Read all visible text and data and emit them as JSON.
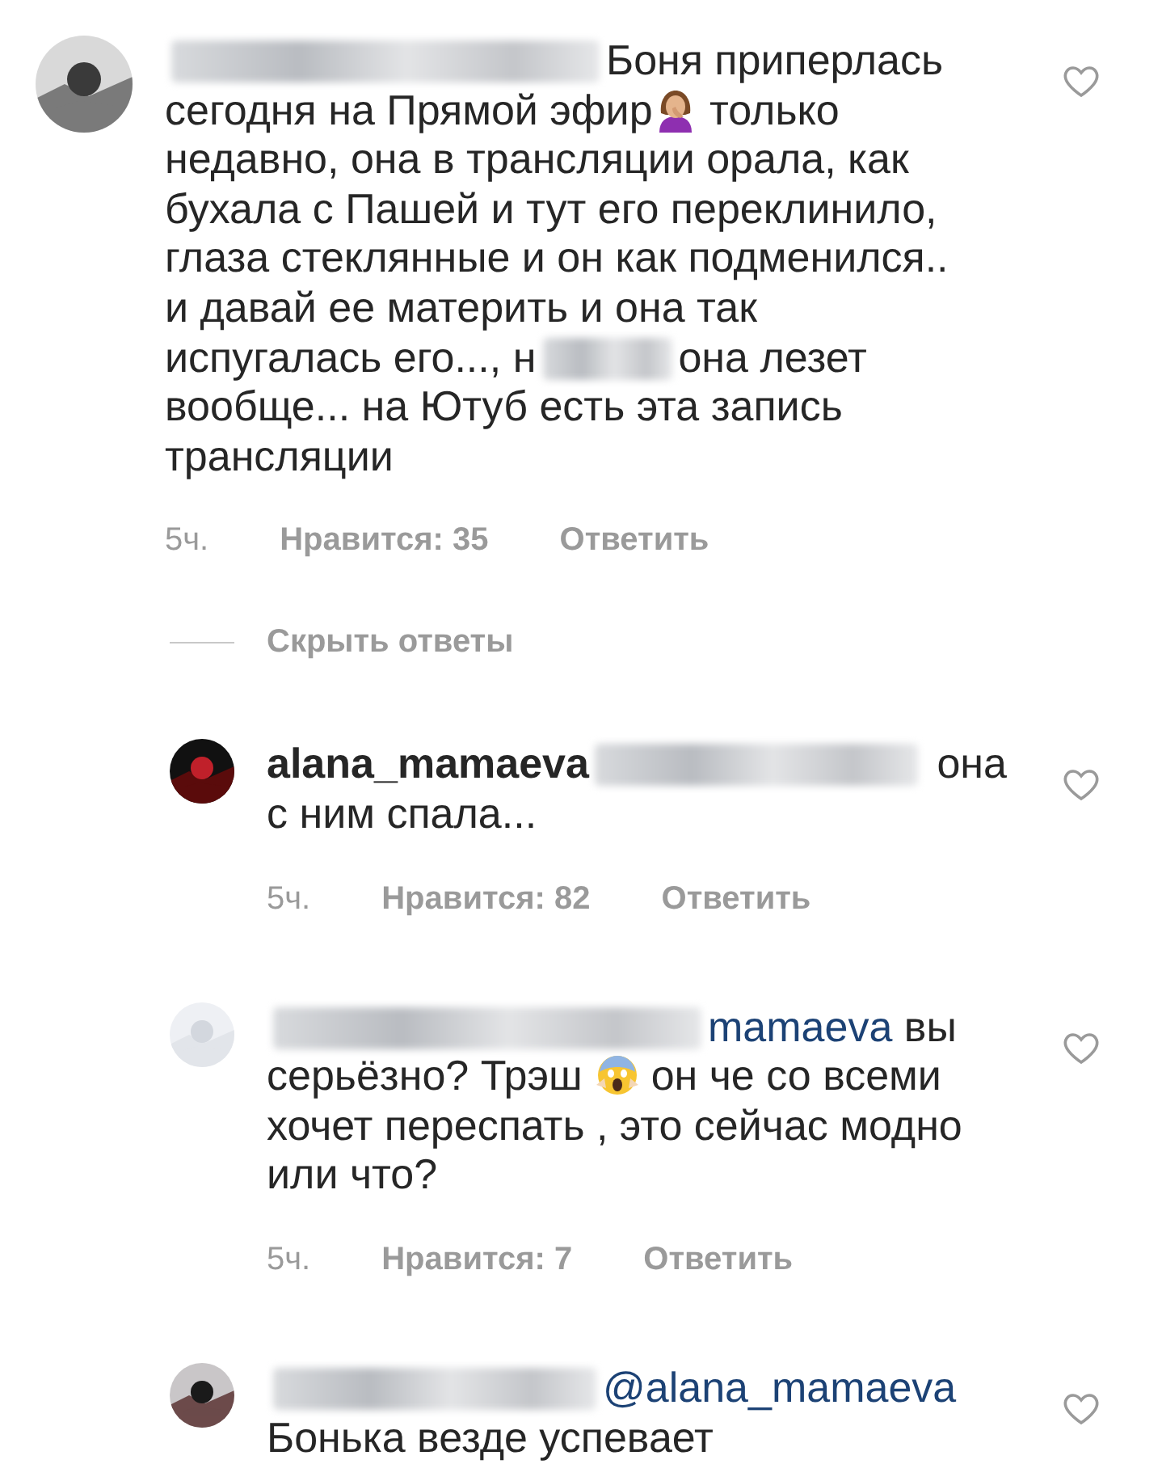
{
  "comments": [
    {
      "body": [
        {
          "kind": "redacted_long"
        },
        {
          "kind": "text",
          "text": "Боня приперлась сегодня на Прямой эфир"
        },
        {
          "kind": "emoji_person"
        },
        {
          "kind": "text",
          "text": " только недавно, она в трансляции  орала, как бухала с Пашей и тут его переклинило, глаза стеклянные и он как подменился.. и давай ее материть и она так испугалась его..., н"
        },
        {
          "kind": "redacted_short"
        },
        {
          "kind": "text",
          "text": "она лезет вообще... на Ютуб есть эта запись трансляции"
        }
      ],
      "time": "5ч.",
      "likes": "Нравится: 35",
      "reply": "Ответить",
      "liked": false,
      "hide_replies": "Скрыть ответы",
      "replies": [
        {
          "body": [
            {
              "kind": "username",
              "text": "alana_mamaeva"
            },
            {
              "kind": "redacted_mid"
            },
            {
              "kind": "text",
              "text": " она с ним спала..."
            }
          ],
          "time": "5ч.",
          "likes": "Нравится: 82",
          "reply": "Ответить",
          "liked": false
        },
        {
          "body": [
            {
              "kind": "redacted_long"
            },
            {
              "kind": "mention",
              "text": "mamaeva"
            },
            {
              "kind": "text",
              "text": " вы серьёзно? Трэш "
            },
            {
              "kind": "emoji_scream"
            },
            {
              "kind": "text",
              "text": " он че со всеми хочет переспать , это сейчас модно или что?"
            }
          ],
          "time": "5ч.",
          "likes": "Нравится: 7",
          "reply": "Ответить",
          "liked": false
        },
        {
          "body": [
            {
              "kind": "redacted_mid"
            },
            {
              "kind": "mention",
              "text": "@alana_mamaeva"
            },
            {
              "kind": "text",
              "text": " Бонька везде успевает"
            }
          ],
          "liked": false
        }
      ]
    }
  ]
}
